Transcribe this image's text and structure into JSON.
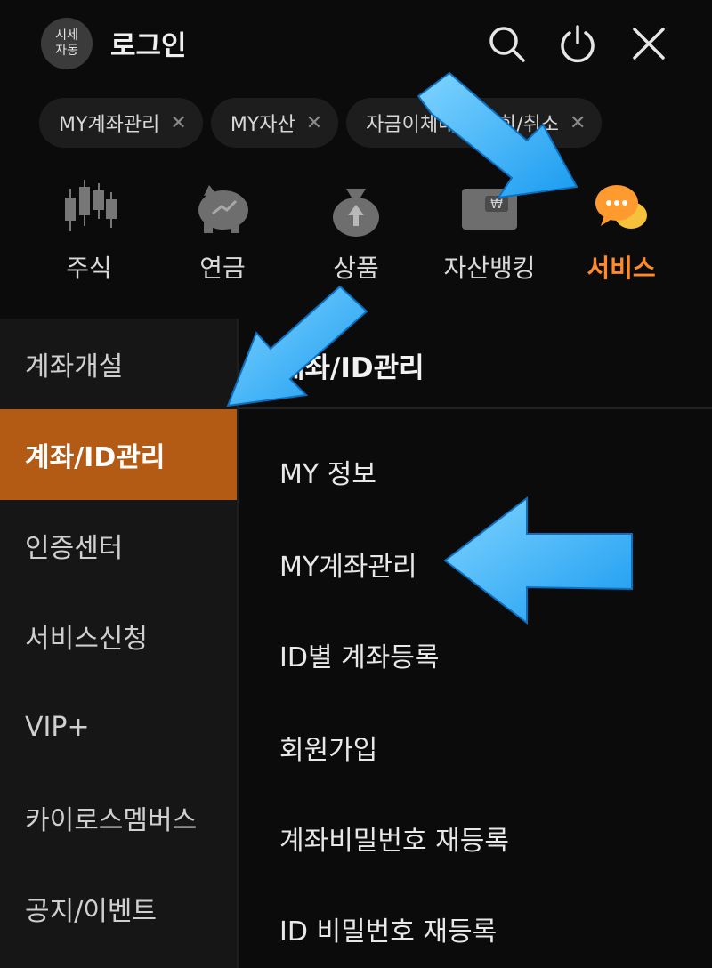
{
  "header": {
    "auto_badge": [
      "시세",
      "자동"
    ],
    "login": "로그인",
    "icons": [
      "search-icon",
      "power-icon",
      "close-icon"
    ]
  },
  "chips": [
    {
      "label": "MY계좌관리"
    },
    {
      "label": "MY자산"
    },
    {
      "label": "자금이체내역 조회/취소"
    }
  ],
  "categories": [
    {
      "label": "주식",
      "icon": "stock-candle-icon"
    },
    {
      "label": "연금",
      "icon": "piggy-bank-icon"
    },
    {
      "label": "상품",
      "icon": "money-bag-icon"
    },
    {
      "label": "자산뱅킹",
      "icon": "wallet-icon"
    },
    {
      "label": "서비스",
      "icon": "chat-bubble-icon",
      "active": true
    }
  ],
  "left_nav": [
    {
      "label": "계좌개설"
    },
    {
      "label": "계좌/ID관리",
      "active": true
    },
    {
      "label": "인증센터"
    },
    {
      "label": "서비스신청"
    },
    {
      "label": "VIP+"
    },
    {
      "label": "카이로스멤버스"
    },
    {
      "label": "공지/이벤트"
    }
  ],
  "right_pane": {
    "title": "계좌/ID관리",
    "items": [
      {
        "label": "MY 정보"
      },
      {
        "label": "MY계좌관리"
      },
      {
        "label": "ID별 계좌등록"
      },
      {
        "label": "회원가입"
      },
      {
        "label": "계좌비밀번호 재등록"
      },
      {
        "label": "ID 비밀번호 재등록"
      }
    ]
  },
  "colors": {
    "background": "#0b0b0b",
    "accent": "#ff8a2a",
    "active_nav": "#b35a15",
    "arrow": "#2aa8f5"
  }
}
